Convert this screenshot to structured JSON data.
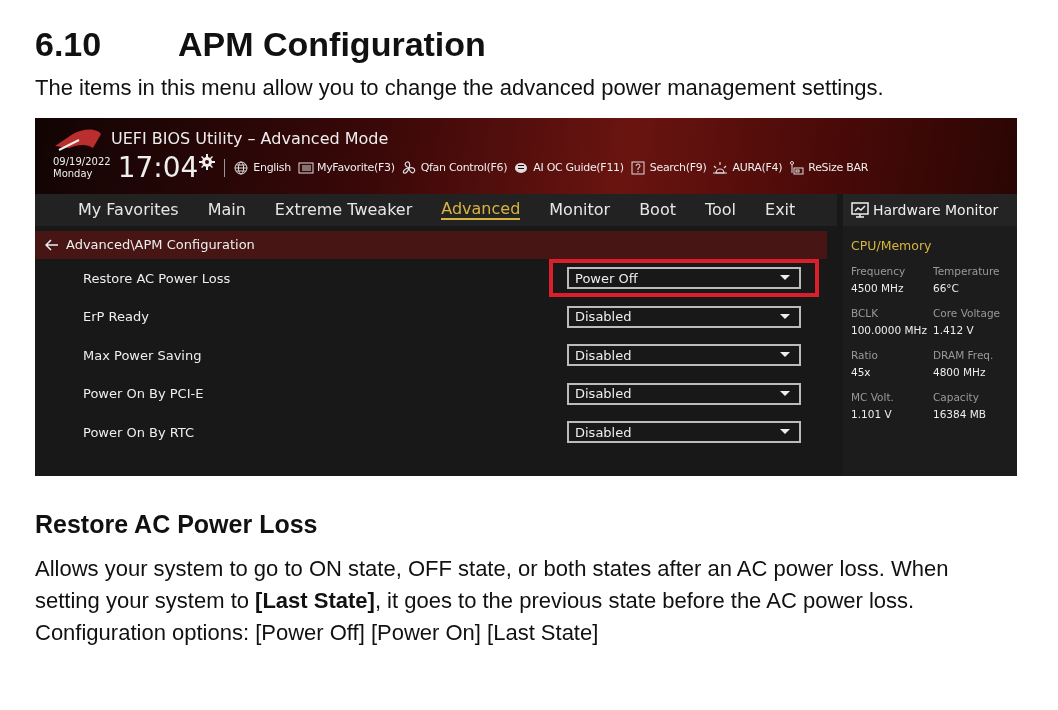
{
  "section": {
    "number": "6.10",
    "title": "APM Configuration",
    "intro": "The items in this menu allow you to change the advanced power management settings."
  },
  "bios": {
    "title": "UEFI BIOS Utility – Advanced Mode",
    "date": "09/19/2022",
    "day": "Monday",
    "time": "17:04",
    "tools": [
      {
        "kind": "globe",
        "label": "English"
      },
      {
        "kind": "list",
        "label": "MyFavorite(F3)"
      },
      {
        "kind": "fan",
        "label": "Qfan Control(F6)"
      },
      {
        "kind": "chip",
        "label": "AI OC Guide(F11)"
      },
      {
        "kind": "help",
        "label": "Search(F9)"
      },
      {
        "kind": "aura",
        "label": "AURA(F4)"
      },
      {
        "kind": "bar",
        "label": "ReSize BAR"
      }
    ],
    "tabs": [
      {
        "label": "My Favorites",
        "selected": false
      },
      {
        "label": "Main",
        "selected": false
      },
      {
        "label": "Extreme Tweaker",
        "selected": false
      },
      {
        "label": "Advanced",
        "selected": true
      },
      {
        "label": "Monitor",
        "selected": false
      },
      {
        "label": "Boot",
        "selected": false
      },
      {
        "label": "Tool",
        "selected": false
      },
      {
        "label": "Exit",
        "selected": false
      }
    ],
    "breadcrumb": "Advanced\\APM Configuration",
    "settings": [
      {
        "label": "Restore AC Power Loss",
        "value": "Power Off",
        "highlighted": true
      },
      {
        "label": "ErP Ready",
        "value": "Disabled",
        "highlighted": false
      },
      {
        "label": "Max Power Saving",
        "value": "Disabled",
        "highlighted": false
      },
      {
        "label": "Power On By PCI-E",
        "value": "Disabled",
        "highlighted": false
      },
      {
        "label": "Power On By RTC",
        "value": "Disabled",
        "highlighted": false
      }
    ],
    "monitor": {
      "title": "Hardware Monitor",
      "group": "CPU/Memory",
      "readings": [
        {
          "name": "Frequency",
          "value": "4500 MHz"
        },
        {
          "name": "Temperature",
          "value": "66°C"
        },
        {
          "name": "BCLK",
          "value": "100.0000 MHz"
        },
        {
          "name": "Core Voltage",
          "value": "1.412 V"
        },
        {
          "name": "Ratio",
          "value": "45x"
        },
        {
          "name": "DRAM Freq.",
          "value": "4800 MHz"
        },
        {
          "name": "MC Volt.",
          "value": "1.101 V"
        },
        {
          "name": "Capacity",
          "value": "16384 MB"
        }
      ]
    }
  },
  "detail": {
    "title": "Restore AC Power Loss",
    "paragraphs": [
      "Allows your system to go to ON state, OFF state, or both states after an AC power loss. When setting your system to **[Last State]**, it goes to the previous state before the AC power loss.",
      "Configuration options: [Power Off] [Power On] [Last State]"
    ]
  }
}
